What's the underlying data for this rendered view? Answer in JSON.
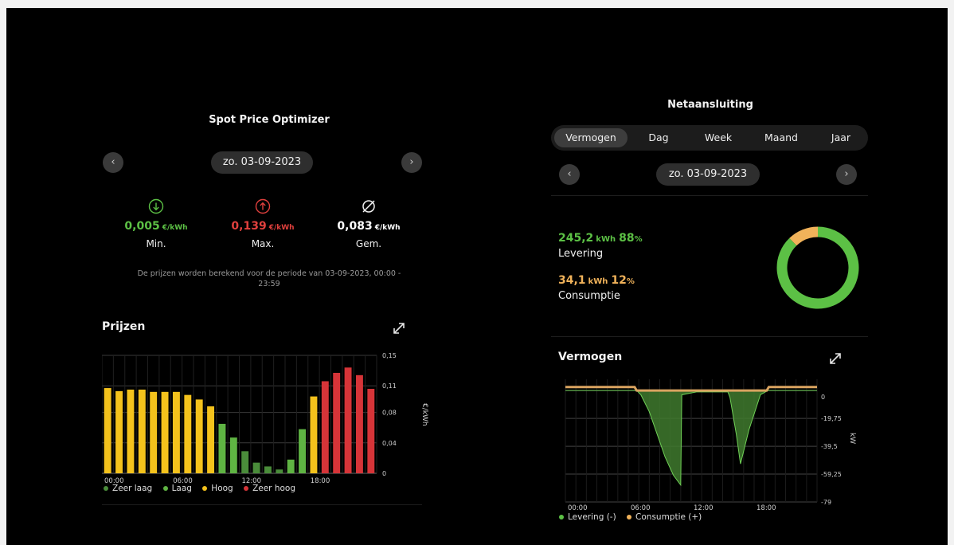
{
  "colors": {
    "very_low": "#4a8c3a",
    "low": "#5fb443",
    "high": "#f4c21c",
    "very_high": "#d63438",
    "levering": "#5cc045",
    "consumptie": "#f0b25a"
  },
  "left_panel": {
    "title": "Spot Price Optimizer",
    "prev_icon": "chevron-left-icon",
    "next_icon": "chevron-right-icon",
    "date": "zo. 03-09-2023",
    "stats": [
      {
        "icon": "arrow-down-circle-icon",
        "value": "0,005",
        "unit": "€/kWh",
        "label": "Min.",
        "color": "#5cc045"
      },
      {
        "icon": "arrow-up-circle-icon",
        "value": "0,139",
        "unit": "€/kWh",
        "label": "Max.",
        "color": "#e0403d"
      },
      {
        "icon": "average-icon",
        "value": "0,083",
        "unit": "€/kWh",
        "label": "Gem.",
        "color": "#ffffff"
      }
    ],
    "note_line1": "De prijzen worden berekend voor de periode van 03-09-2023, 00:00 -",
    "note_line2": "23:59",
    "prices_title": "Prijzen",
    "expand_icon": "expand-icon",
    "legend": [
      {
        "label": "Zeer laag",
        "color_key": "very_low"
      },
      {
        "label": "Laag",
        "color_key": "low"
      },
      {
        "label": "Hoog",
        "color_key": "high"
      },
      {
        "label": "Zeer hoog",
        "color_key": "very_high"
      }
    ]
  },
  "right_panel": {
    "title": "Netaansluiting",
    "tabs": [
      {
        "label": "Vermogen",
        "active": true
      },
      {
        "label": "Dag",
        "active": false
      },
      {
        "label": "Week",
        "active": false
      },
      {
        "label": "Maand",
        "active": false
      },
      {
        "label": "Jaar",
        "active": false
      }
    ],
    "date": "zo. 03-09-2023",
    "levering": {
      "value": "245,2",
      "unit": "kWh",
      "pct": "88",
      "pct_unit": "%",
      "label": "Levering"
    },
    "consumptie": {
      "value": "34,1",
      "unit": "kWh",
      "pct": "12",
      "pct_unit": "%",
      "label": "Consumptie"
    },
    "power_title": "Vermogen",
    "legend": [
      {
        "label": "Levering (-)",
        "color_key": "levering"
      },
      {
        "label": "Consumptie (+)",
        "color_key": "consumptie"
      }
    ]
  },
  "chart_data": [
    {
      "type": "bar",
      "title": "Prijzen",
      "ylabel": "€/kWh",
      "x_tick_labels": [
        "00:00",
        "06:00",
        "12:00",
        "18:00"
      ],
      "y_tick_labels": [
        "0",
        "0,04",
        "0,08",
        "0,11",
        "0,15"
      ],
      "ylim": [
        0,
        0.155
      ],
      "hours": [
        "00",
        "01",
        "02",
        "03",
        "04",
        "05",
        "06",
        "07",
        "08",
        "09",
        "10",
        "11",
        "12",
        "13",
        "14",
        "15",
        "16",
        "17",
        "18",
        "19",
        "20",
        "21",
        "22",
        "23"
      ],
      "values": [
        0.112,
        0.108,
        0.11,
        0.11,
        0.107,
        0.107,
        0.107,
        0.103,
        0.097,
        0.088,
        0.065,
        0.047,
        0.029,
        0.014,
        0.009,
        0.005,
        0.018,
        0.058,
        0.101,
        0.121,
        0.132,
        0.139,
        0.129,
        0.111
      ],
      "levels": [
        "high",
        "high",
        "high",
        "high",
        "high",
        "high",
        "high",
        "high",
        "high",
        "high",
        "low",
        "low",
        "very_low",
        "very_low",
        "very_low",
        "very_low",
        "low",
        "low",
        "high",
        "very_high",
        "very_high",
        "very_high",
        "very_high",
        "very_high"
      ],
      "legend": [
        "Zeer laag",
        "Laag",
        "Hoog",
        "Zeer hoog"
      ],
      "grid": true
    },
    {
      "type": "area",
      "title": "Vermogen",
      "ylabel": "kW",
      "x_tick_labels": [
        "00:00",
        "06:00",
        "12:00",
        "18:00"
      ],
      "y_tick_labels": [
        "0",
        "-19,75",
        "-39,5",
        "-59,25",
        "-79"
      ],
      "ylim": [
        -79,
        8
      ],
      "series": [
        {
          "name": "Levering (-)",
          "x": [
            0,
            6.8,
            7.2,
            8,
            8.8,
            9.5,
            10.3,
            11.0,
            11.1,
            12.5,
            13.6,
            15.5,
            15.7,
            16.3,
            16.7,
            17.5,
            18.6,
            19.3,
            24
          ],
          "values": [
            0,
            0,
            -3,
            -15,
            -32,
            -47,
            -60,
            -67,
            -3,
            -1,
            -1,
            -1,
            -5,
            -31,
            -52,
            -28,
            -3,
            0,
            0
          ]
        },
        {
          "name": "Consumptie (+)",
          "x": [
            0,
            6.6,
            6.8,
            11.0,
            11.2,
            15.4,
            15.6,
            19.2,
            19.4,
            24
          ],
          "values": [
            2.5,
            2.5,
            0,
            0,
            0,
            0,
            0,
            0,
            2.5,
            2.5
          ]
        }
      ],
      "legend": [
        "Levering (-)",
        "Consumptie (+)"
      ],
      "grid": true
    },
    {
      "type": "pie",
      "categories": [
        "Levering",
        "Consumptie"
      ],
      "values": [
        245.2,
        34.1
      ]
    }
  ]
}
